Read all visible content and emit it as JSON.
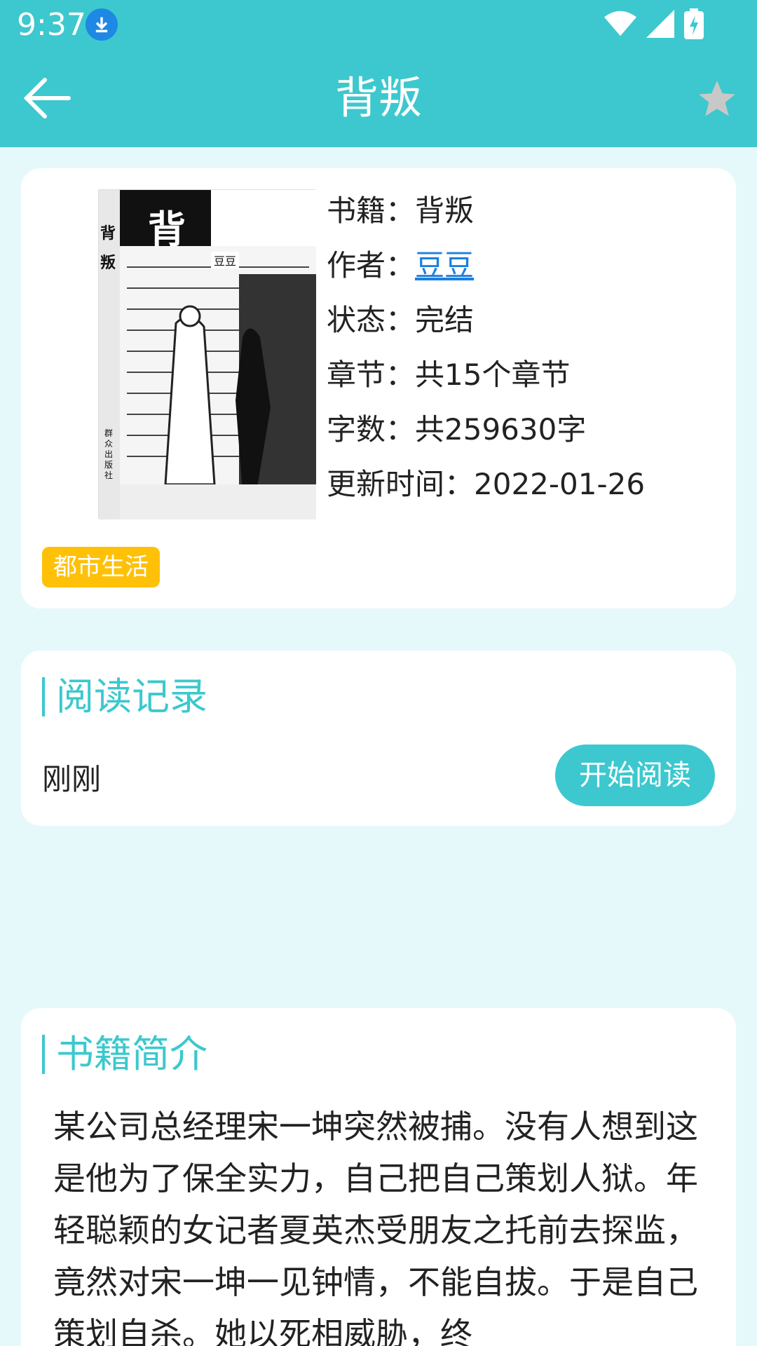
{
  "status_bar": {
    "time": "9:37"
  },
  "app_bar": {
    "title": "背叛"
  },
  "book": {
    "cover_title": "背  叛",
    "cover_title_vertical": "背 叛",
    "cover_author": "豆豆",
    "cover_publisher": "群众出版社",
    "meta": [
      {
        "label": "书籍：",
        "value": "背叛"
      },
      {
        "label": "作者：",
        "value": "豆豆"
      },
      {
        "label": "状态：",
        "value": "完结"
      },
      {
        "label": "章节：",
        "value": "共15个章节"
      },
      {
        "label": "字数：",
        "value": "共259630字"
      },
      {
        "label": "更新时间：",
        "value": "2022-01-26"
      }
    ],
    "tag": "都市生活"
  },
  "reading_record": {
    "title": "阅读记录",
    "time": "刚刚",
    "button": "开始阅读"
  },
  "intro": {
    "title": "书籍简介",
    "text": "某公司总经理宋一坤突然被捕。没有人想到这是他为了保全实力，自己把自己策划人狱。年轻聪颖的女记者夏英杰受朋友之托前去探监，竟然对宋一坤一见钟情，不能自拔。于是自己策划自杀。她以死相威胁，终"
  },
  "colors": {
    "accent": "#3CC8CE",
    "tag": "#FFC107",
    "link": "#1E7FE0",
    "background": "#E6F9FA"
  }
}
